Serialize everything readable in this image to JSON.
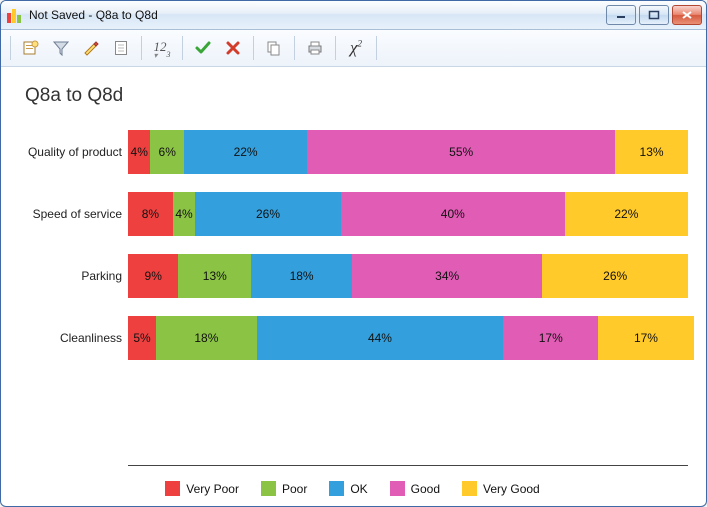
{
  "window": {
    "title": "Not Saved - Q8a to Q8d"
  },
  "toolbar": {
    "icons": [
      "properties",
      "funnel",
      "brush",
      "page",
      "numeric",
      "check",
      "cross",
      "copy",
      "print",
      "chi2"
    ]
  },
  "colors": {
    "very_poor": "#ef4040",
    "poor": "#8bc444",
    "ok": "#33a0dd",
    "good": "#e05cb5",
    "very_good": "#ffca2a"
  },
  "chart_title": "Q8a to Q8d",
  "chart_data": {
    "type": "bar",
    "orientation": "horizontal-stacked",
    "unit": "percent",
    "xlim": [
      0,
      100
    ],
    "series_levels": [
      "Very Poor",
      "Poor",
      "OK",
      "Good",
      "Very Good"
    ],
    "categories": [
      "Quality of product",
      "Speed of service",
      "Parking",
      "Cleanliness"
    ],
    "series": [
      {
        "name": "Very Poor",
        "values": [
          4,
          8,
          9,
          5
        ]
      },
      {
        "name": "Poor",
        "values": [
          6,
          4,
          13,
          18
        ]
      },
      {
        "name": "OK",
        "values": [
          22,
          26,
          18,
          44
        ]
      },
      {
        "name": "Good",
        "values": [
          55,
          40,
          34,
          17
        ]
      },
      {
        "name": "Very Good",
        "values": [
          13,
          22,
          26,
          17
        ]
      }
    ],
    "legend": [
      "Very Poor",
      "Poor",
      "OK",
      "Good",
      "Very Good"
    ]
  }
}
